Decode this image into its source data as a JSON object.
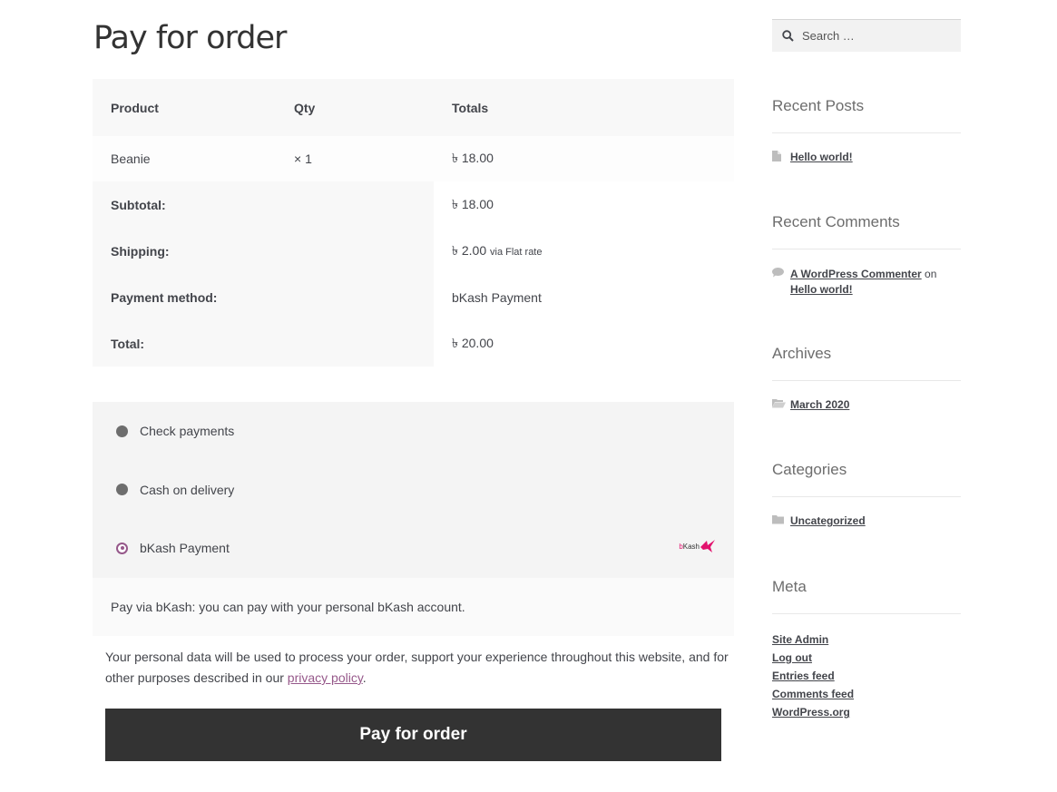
{
  "page": {
    "title": "Pay for order"
  },
  "order_table": {
    "headers": {
      "product": "Product",
      "qty": "Qty",
      "totals": "Totals"
    },
    "items": [
      {
        "product": "Beanie",
        "qty": "× 1",
        "total": "৳ 18.00"
      }
    ],
    "subtotal": {
      "label": "Subtotal:",
      "value": "৳ 18.00"
    },
    "shipping": {
      "label": "Shipping:",
      "value": "৳ 2.00",
      "via": "via Flat rate"
    },
    "payment_method": {
      "label": "Payment method:",
      "value": "bKash Payment"
    },
    "total": {
      "label": "Total:",
      "value": "৳ 20.00"
    }
  },
  "payment_methods": [
    {
      "label": "Check payments",
      "selected": false
    },
    {
      "label": "Cash on delivery",
      "selected": false
    },
    {
      "label": "bKash Payment",
      "selected": true
    }
  ],
  "bkash_logo_text": {
    "b": "b",
    "rest": "Kash"
  },
  "payment_description": "Pay via bKash: you can pay with your personal bKash account.",
  "privacy": {
    "text": "Your personal data will be used to process your order, support your experience throughout this website, and for other purposes described in our ",
    "link": "privacy policy",
    "end": "."
  },
  "pay_button": "Pay for order",
  "sidebar": {
    "search_placeholder": "Search …",
    "recent_posts": {
      "title": "Recent Posts",
      "items": [
        "Hello world!"
      ]
    },
    "recent_comments": {
      "title": "Recent Comments",
      "author": "A WordPress Commenter",
      "on": "on",
      "post": "Hello world!"
    },
    "archives": {
      "title": "Archives",
      "items": [
        "March 2020"
      ]
    },
    "categories": {
      "title": "Categories",
      "items": [
        "Uncategorized"
      ]
    },
    "meta": {
      "title": "Meta",
      "items": [
        "Site Admin",
        "Log out",
        "Entries feed",
        "Comments feed",
        "WordPress.org"
      ]
    }
  },
  "colors": {
    "accent": "#96588a",
    "button": "#333333",
    "bkash": "#e2136e"
  }
}
